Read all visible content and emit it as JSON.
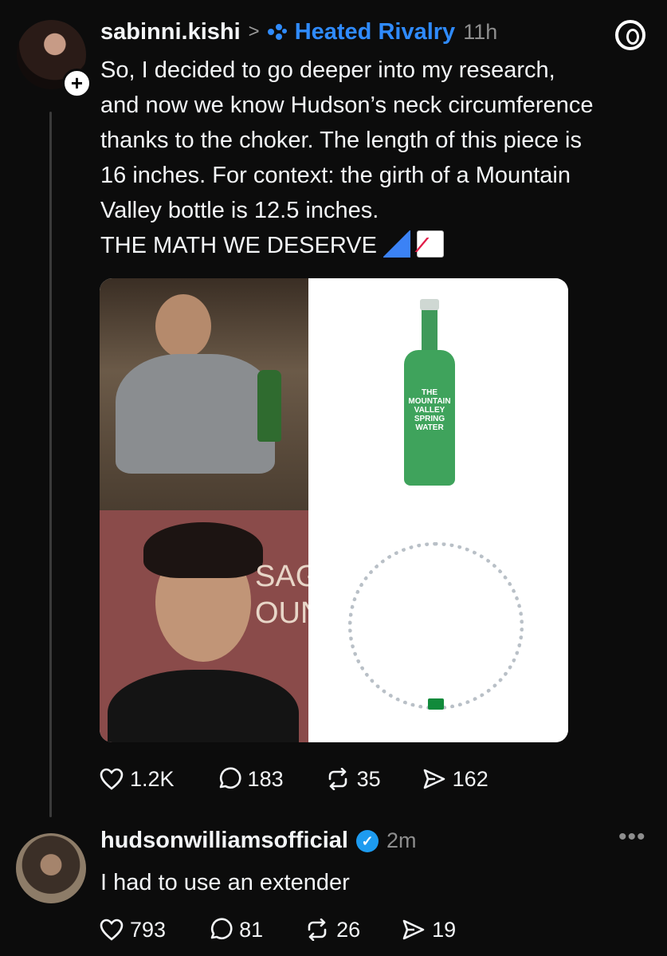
{
  "post": {
    "username": "sabinni.kishi",
    "separator": ">",
    "community": "Heated Rivalry",
    "time": "11h",
    "body_lines": [
      "So, I decided to go deeper into my research,",
      "and now we know Hudson’s neck circumference",
      "thanks to the choker. The length of this piece is",
      "16 inches. For context: the girth of a Mountain",
      "Valley bottle is 12.5 inches."
    ],
    "body_last": "THE MATH WE DESERVE",
    "emojis": [
      "triangular-ruler-icon",
      "chart-increasing-icon"
    ],
    "image_texts": {
      "bottle_label": "THE MOUNTAIN VALLEY SPRING WATER",
      "sign_text": "SAG\nOUN"
    },
    "stats": {
      "likes": "1.2K",
      "replies": "183",
      "reposts": "35",
      "shares": "162"
    }
  },
  "reply": {
    "username": "hudsonwilliamsofficial",
    "verified_mark": "✓",
    "time": "2m",
    "text": "I had to use an extender",
    "stats": {
      "likes": "793",
      "replies": "81",
      "reposts": "26",
      "shares": "19"
    },
    "more_label": "•••"
  },
  "colors": {
    "background": "#0c0c0c",
    "text": "#f3f5f7",
    "muted": "#8e8e8e",
    "community_blue": "#2f8bff",
    "verified_blue": "#1d9bf0"
  }
}
